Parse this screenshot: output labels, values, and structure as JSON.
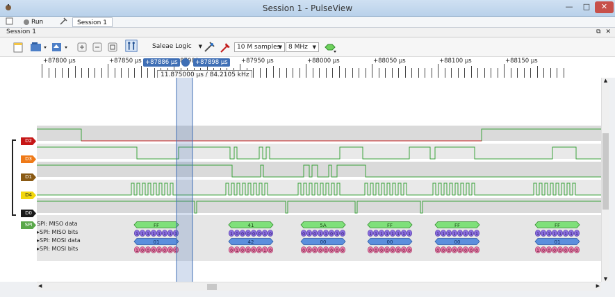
{
  "window": {
    "title": "Session 1 - PulseView",
    "min_glyph": "—",
    "max_glyph": "□",
    "close_glyph": "✕"
  },
  "tabs": {
    "run_label": "Run",
    "session_label": "Session 1"
  },
  "session_bar": {
    "title": "Session 1",
    "float_glyph": "⧉",
    "close_glyph": "✕"
  },
  "toolbar": {
    "device": "Saleae Logic",
    "samples": "10 M samples",
    "rate": "8 MHz"
  },
  "ruler": {
    "unit": "µs",
    "ticks": [
      "+87800",
      "+87850",
      "+87900",
      "+87950",
      "+88000",
      "+88050",
      "+88100",
      "+88150"
    ],
    "cursor1": "+87886 µs",
    "cursor2": "+87898 µs"
  },
  "tooltip": "11.875000 µs / 84.2105 kHz",
  "colors": {
    "d2": "#c61616",
    "d3": "#ef7a18",
    "d1": "#8a5a14",
    "d4": "#f2d70e",
    "d0": "#1a1a1a",
    "spi": "#5aa84a",
    "high": "#3aa33a",
    "low": "#c21c1c"
  },
  "channels": [
    {
      "name": "D2",
      "color": "#c61616",
      "row": 0
    },
    {
      "name": "D3",
      "color": "#ef7a18",
      "row": 1
    },
    {
      "name": "D1",
      "color": "#8a5a14",
      "row": 2
    },
    {
      "name": "D4",
      "color": "#f2d70e",
      "row": 3
    },
    {
      "name": "D0",
      "color": "#1a1a1a",
      "row": 4
    }
  ],
  "decoder": {
    "name": "SPI",
    "rows": [
      "SPI: MISO data",
      "SPI: MISO bits",
      "SPI: MOSI data",
      "SPI: MOSI bits"
    ],
    "miso_data": [
      "FF",
      "41",
      "5A",
      "FF",
      "FF",
      "FF"
    ],
    "mosi_data": [
      "01",
      "42",
      "00",
      "00",
      "00",
      "01"
    ],
    "miso_bits": [
      [
        "1",
        "1",
        "1",
        "1",
        "1",
        "1",
        "1",
        "1"
      ],
      [
        "1",
        "0",
        "0",
        "0",
        "0",
        "0",
        "1",
        "0"
      ],
      [
        "0",
        "1",
        "0",
        "1",
        "1",
        "0",
        "1",
        "0"
      ],
      [
        "1",
        "1",
        "1",
        "1",
        "1",
        "1",
        "1",
        "1"
      ],
      [
        "1",
        "1",
        "1",
        "1",
        "1",
        "1",
        "1",
        "1"
      ],
      [
        "1",
        "1",
        "1",
        "1",
        "1",
        "1",
        "1",
        "1"
      ]
    ],
    "mosi_bits": [
      [
        "1",
        "0",
        "0",
        "0",
        "0",
        "0",
        "0",
        "0"
      ],
      [
        "0",
        "1",
        "0",
        "0",
        "0",
        "0",
        "1",
        "0"
      ],
      [
        "0",
        "0",
        "0",
        "0",
        "0",
        "0",
        "0",
        "0"
      ],
      [
        "0",
        "0",
        "0",
        "0",
        "0",
        "0",
        "0",
        "0"
      ],
      [
        "0",
        "0",
        "0",
        "0",
        "0",
        "0",
        "0",
        "0"
      ],
      [
        "1",
        "0",
        "0",
        "0",
        "0",
        "0",
        "0",
        "0"
      ]
    ]
  }
}
